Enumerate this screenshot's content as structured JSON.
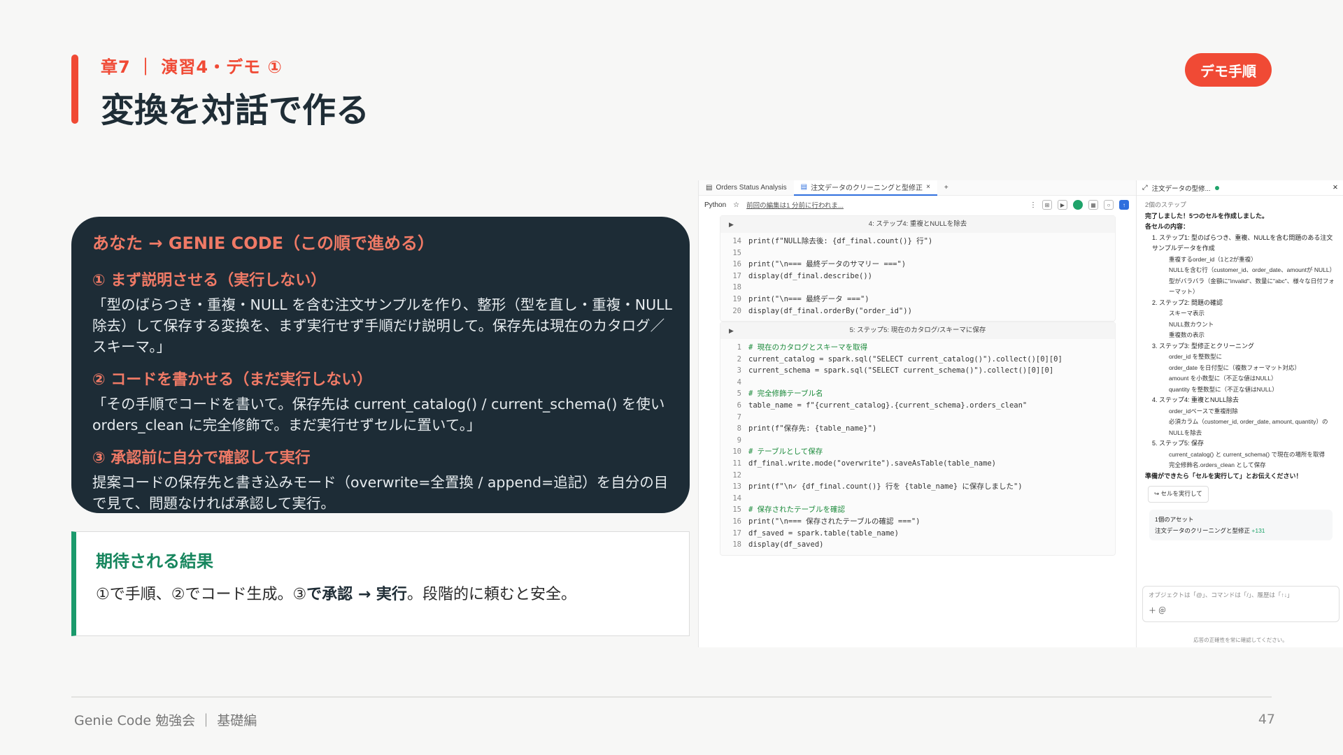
{
  "header": {
    "chapter": "章7 ｜ 演習4・デモ ①",
    "title": "変換を対話で作る",
    "badge": "デモ手順"
  },
  "instructions": {
    "heading": "あなた → GENIE CODE（この順で進める）",
    "steps": [
      {
        "head": "① まず説明させる（実行しない）",
        "body": "「型のばらつき・重複・NULL を含む注文サンプルを作り、整形（型を直し・重複・NULL 除去）して保存する変換を、まず実行せず手順だけ説明して。保存先は現在のカタログ／スキーマ。」"
      },
      {
        "head": "② コードを書かせる（まだ実行しない）",
        "body": "「その手順でコードを書いて。保存先は current_catalog() / current_schema() を使い orders_clean に完全修飾で。まだ実行せずセルに置いて。」"
      },
      {
        "head": "③ 承認前に自分で確認して実行",
        "body": "提案コードの保存先と書き込みモード（overwrite=全置換 / append=追記）を自分の目で見て、問題なければ承認して実行。"
      }
    ]
  },
  "result": {
    "title": "期待される結果",
    "part1": "①で手順、②でコード生成。③",
    "bold1": "で承認 → 実行",
    "part2": "。段階的に頼むと安全。"
  },
  "notebook": {
    "tabs": [
      "Orders Status Analysis",
      "注文データのクリーニングと型修正"
    ],
    "language": "Python",
    "edited": "前回の編集は1 分前に行われま...",
    "cell1": {
      "title": "4: ステップ4: 重複とNULLを除去",
      "lines": [
        {
          "n": "14",
          "t": "print(f\"NULL除去後: {df_final.count()} 行\")"
        },
        {
          "n": "15",
          "t": ""
        },
        {
          "n": "16",
          "t": "print(\"\\n=== 最終データのサマリー ===\")"
        },
        {
          "n": "17",
          "t": "display(df_final.describe())"
        },
        {
          "n": "18",
          "t": ""
        },
        {
          "n": "19",
          "t": "print(\"\\n=== 最終データ ===\")"
        },
        {
          "n": "20",
          "t": "display(df_final.orderBy(\"order_id\"))"
        }
      ]
    },
    "cell2": {
      "title": "5: ステップ5: 現在のカタログ/スキーマに保存",
      "lines": [
        {
          "n": "1",
          "t": "# 現在のカタログとスキーマを取得"
        },
        {
          "n": "2",
          "t": "current_catalog = spark.sql(\"SELECT current_catalog()\").collect()[0][0]"
        },
        {
          "n": "3",
          "t": "current_schema = spark.sql(\"SELECT current_schema()\").collect()[0][0]"
        },
        {
          "n": "4",
          "t": ""
        },
        {
          "n": "5",
          "t": "# 完全修飾テーブル名"
        },
        {
          "n": "6",
          "t": "table_name = f\"{current_catalog}.{current_schema}.orders_clean\""
        },
        {
          "n": "7",
          "t": ""
        },
        {
          "n": "8",
          "t": "print(f\"保存先: {table_name}\")"
        },
        {
          "n": "9",
          "t": ""
        },
        {
          "n": "10",
          "t": "# テーブルとして保存"
        },
        {
          "n": "11",
          "t": "df_final.write.mode(\"overwrite\").saveAsTable(table_name)"
        },
        {
          "n": "12",
          "t": ""
        },
        {
          "n": "13",
          "t": "print(f\"\\n✓ {df_final.count()} 行を {table_name} に保存しました\")"
        },
        {
          "n": "14",
          "t": ""
        },
        {
          "n": "15",
          "t": "# 保存されたテーブルを確認"
        },
        {
          "n": "16",
          "t": "print(\"\\n=== 保存されたテーブルの確認 ===\")"
        },
        {
          "n": "17",
          "t": "df_saved = spark.table(table_name)"
        },
        {
          "n": "18",
          "t": "display(df_saved)"
        }
      ]
    }
  },
  "assistant": {
    "title": "注文データの型修...",
    "steps_count": "2個のステップ",
    "done": "完了しました！5つのセルを作成しました。",
    "contents_label": "各セルの内容：",
    "items": [
      {
        "head": "1. ステップ1: 型のばらつき、重複、NULLを含む問題のある注文サンプルデータを作成",
        "subs": [
          "重複するorder_id（1と2が重複）",
          "NULLを含む行（customer_id、order_date、amountが NULL）",
          "型がバラバラ（金額に\"invalid\"、数量に\"abc\"、様々な日付フォーマット）"
        ]
      },
      {
        "head": "2. ステップ2: 問題の確認",
        "subs": [
          "スキーマ表示",
          "NULL数カウント",
          "重複数の表示"
        ]
      },
      {
        "head": "3. ステップ3: 型修正とクリーニング",
        "subs": [
          "order_id を整数型に",
          "order_date を日付型に（複数フォーマット対応）",
          "amount を小数型に（不正な値はNULL）",
          "quantity を整数型に（不正な値はNULL）"
        ]
      },
      {
        "head": "4. ステップ4: 重複とNULL除去",
        "subs": [
          "order_idベースで重複削除",
          "必須カラム（customer_id, order_date, amount, quantity）のNULLを除去"
        ]
      },
      {
        "head": "5. ステップ5: 保存",
        "subs": [
          "current_catalog() と current_schema() で現在の場所を取得",
          "完全修飾名.orders_clean として保存"
        ]
      }
    ],
    "ready": "準備ができたら「セルを実行して」とお伝えください！",
    "run_button": "↪ セルを実行して",
    "assets_label": "1個のアセット",
    "asset_name": "注文データのクリーニングと型修正",
    "asset_delta": "+131",
    "input_placeholder": "オブジェクトは「@」、コマンドは「/」、履歴は「↑↓」",
    "disclaimer": "応答の正確性を常に確認してください。"
  },
  "footer": {
    "text": "Genie Code 勉強会 ｜ 基礎編",
    "page": "47"
  },
  "colors": {
    "accent": "#f04a35",
    "dark_card": "#1d2c36",
    "success": "#1a9a6c"
  }
}
